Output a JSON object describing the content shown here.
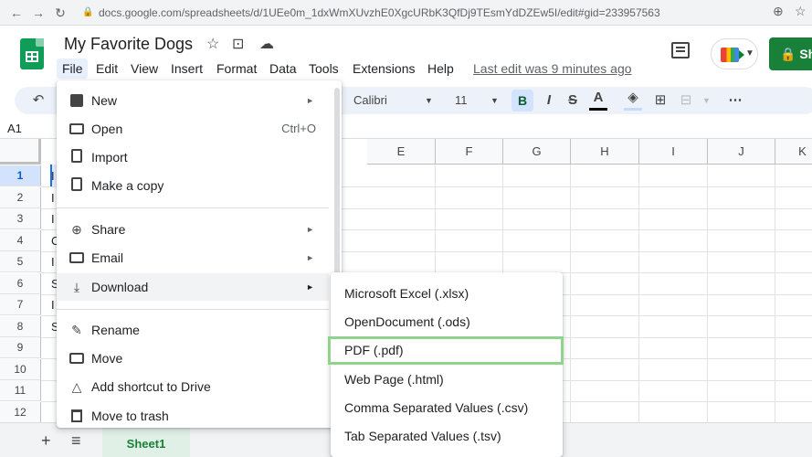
{
  "browser": {
    "url": "docs.google.com/spreadsheets/d/1UEe0m_1dxWmXUvzhE0XgcURbK3QfDj9TEsmYdDZEw5I/edit#gid=233957563"
  },
  "doc": {
    "title": "My Favorite Dogs",
    "last_edit": "Last edit was 9 minutes ago",
    "share_label": "Sh"
  },
  "menu_bar": [
    "File",
    "Edit",
    "View",
    "Insert",
    "Format",
    "Data",
    "Tools",
    "Extensions",
    "Help"
  ],
  "toolbar": {
    "font": "Calibri",
    "font_size": "11",
    "bold": "B"
  },
  "name_box": "A1",
  "columns": [
    "E",
    "F",
    "G",
    "H",
    "I",
    "J",
    "K"
  ],
  "rows": [
    "1",
    "2",
    "3",
    "4",
    "5",
    "6",
    "7",
    "8",
    "9",
    "10",
    "11",
    "12"
  ],
  "cell_fragments": [
    "I",
    "I",
    "I",
    "C",
    "I",
    "S",
    "I",
    "S"
  ],
  "sheet_tab": "Sheet1",
  "file_menu": {
    "items": [
      {
        "label": "New",
        "icon": "new-icon",
        "arrow": "►"
      },
      {
        "label": "Open",
        "icon": "folder-icon",
        "shortcut": "Ctrl+O"
      },
      {
        "label": "Import",
        "icon": "doc-icon"
      },
      {
        "label": "Make a copy",
        "icon": "copy-icon"
      },
      {
        "label": "Share",
        "icon": "share-icon",
        "arrow": "►"
      },
      {
        "label": "Email",
        "icon": "mail-icon",
        "arrow": "►"
      },
      {
        "label": "Download",
        "icon": "download-icon",
        "arrow": "►"
      },
      {
        "label": "Rename",
        "icon": "rename-icon"
      },
      {
        "label": "Move",
        "icon": "move-icon"
      },
      {
        "label": "Add shortcut to Drive",
        "icon": "drive-shortcut-icon"
      },
      {
        "label": "Move to trash",
        "icon": "trash-icon"
      }
    ]
  },
  "download_menu": {
    "items": [
      "Microsoft Excel (.xlsx)",
      "OpenDocument (.ods)",
      "PDF (.pdf)",
      "Web Page (.html)",
      "Comma Separated Values (.csv)",
      "Tab Separated Values (.tsv)"
    ],
    "highlight_color": "#8fd48a"
  },
  "colors": {
    "share_green": "#188038",
    "sheets_green": "#0f9d58"
  }
}
